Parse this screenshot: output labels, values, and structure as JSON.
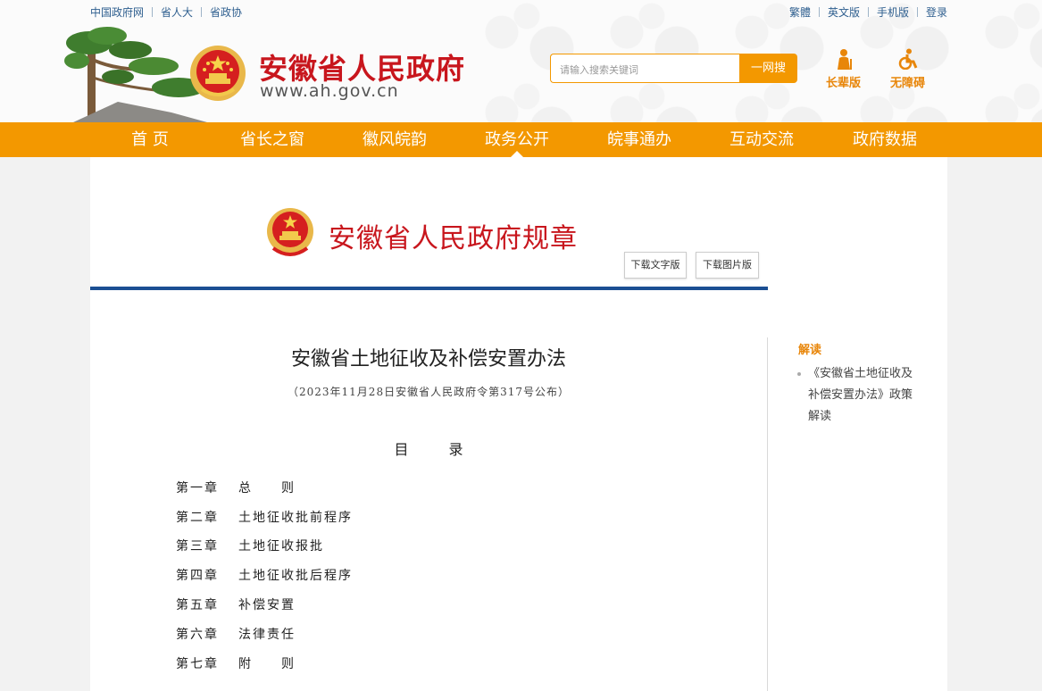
{
  "top_links_left": [
    "中国政府网",
    "省人大",
    "省政协"
  ],
  "top_links_right": [
    "繁體",
    "英文版",
    "手机版",
    "登录"
  ],
  "site": {
    "title": "安徽省人民政府",
    "url": "www.ah.gov.cn"
  },
  "search": {
    "placeholder": "请输入搜索关键词",
    "button": "一网搜"
  },
  "tools": {
    "elder": "长辈版",
    "accessible": "无障碍"
  },
  "nav": [
    "首 页",
    "省长之窗",
    "徽风皖韵",
    "政务公开",
    "皖事通办",
    "互动交流",
    "政府数据"
  ],
  "nav_active": "政务公开",
  "banner": {
    "title": "安徽省人民政府规章",
    "download_text": "下载文字版",
    "download_image": "下载图片版"
  },
  "document": {
    "title": "安徽省土地征收及补偿安置办法",
    "subtitle": "（2023年11月28日安徽省人民政府令第317号公布）",
    "toc_heading": [
      "目",
      "录"
    ],
    "toc": [
      {
        "chapter": "第一章",
        "name": "总　　则"
      },
      {
        "chapter": "第二章",
        "name": "土地征收批前程序"
      },
      {
        "chapter": "第三章",
        "name": "土地征收报批"
      },
      {
        "chapter": "第四章",
        "name": "土地征收批后程序"
      },
      {
        "chapter": "第五章",
        "name": "补偿安置"
      },
      {
        "chapter": "第六章",
        "name": "法律责任"
      },
      {
        "chapter": "第七章",
        "name": "附　　则"
      }
    ]
  },
  "sidebar": {
    "title": "解读",
    "item": "《安徽省土地征收及补偿安置办法》政策解读"
  },
  "colors": {
    "nav_orange": "#f39800",
    "title_red": "#c8161d",
    "rule_blue": "#1b4f93",
    "link_blue": "#2f5f8f"
  }
}
